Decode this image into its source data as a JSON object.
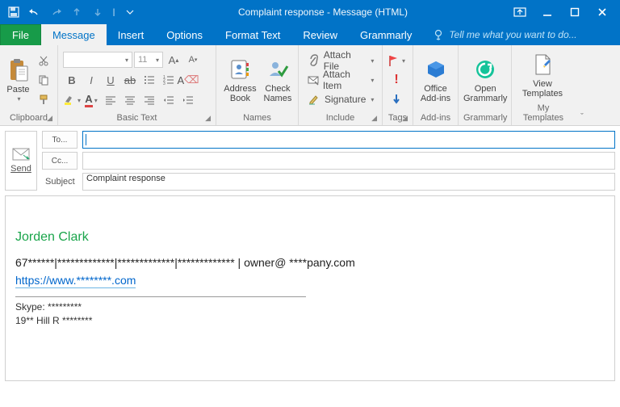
{
  "window": {
    "title": "Complaint response - Message (HTML)"
  },
  "tabs": {
    "file": "File",
    "message": "Message",
    "insert": "Insert",
    "options": "Options",
    "formattext": "Format Text",
    "review": "Review",
    "grammarly": "Grammarly",
    "tellme": "Tell me what you want to do..."
  },
  "ribbon": {
    "clipboard": {
      "label": "Clipboard",
      "paste": "Paste"
    },
    "basictext": {
      "label": "Basic Text",
      "font": "",
      "size": "11"
    },
    "names": {
      "label": "Names",
      "addressbook": "Address\nBook",
      "checknames": "Check\nNames"
    },
    "include": {
      "label": "Include",
      "attachfile": "Attach File",
      "attachitem": "Attach Item",
      "signature": "Signature"
    },
    "tags": {
      "label": "Tags"
    },
    "addins": {
      "label": "Add-ins",
      "office": "Office\nAdd-ins"
    },
    "grammarly": {
      "label": "Grammarly",
      "open": "Open\nGrammarly"
    },
    "mytemplates": {
      "label": "My Templates",
      "view": "View\nTemplates"
    }
  },
  "compose": {
    "send": "Send",
    "to_btn": "To...",
    "cc_btn": "Cc...",
    "subject_lbl": "Subject",
    "to_val": "",
    "cc_val": "",
    "subject_val": "Complaint response"
  },
  "signature": {
    "name": "Jorden Clark",
    "line1": "67******|*************|*************|*************  | owner@ ****pany.com",
    "url": "https://www.********.com",
    "skype": "Skype:  *********",
    "address": "19** Hill R ********"
  }
}
